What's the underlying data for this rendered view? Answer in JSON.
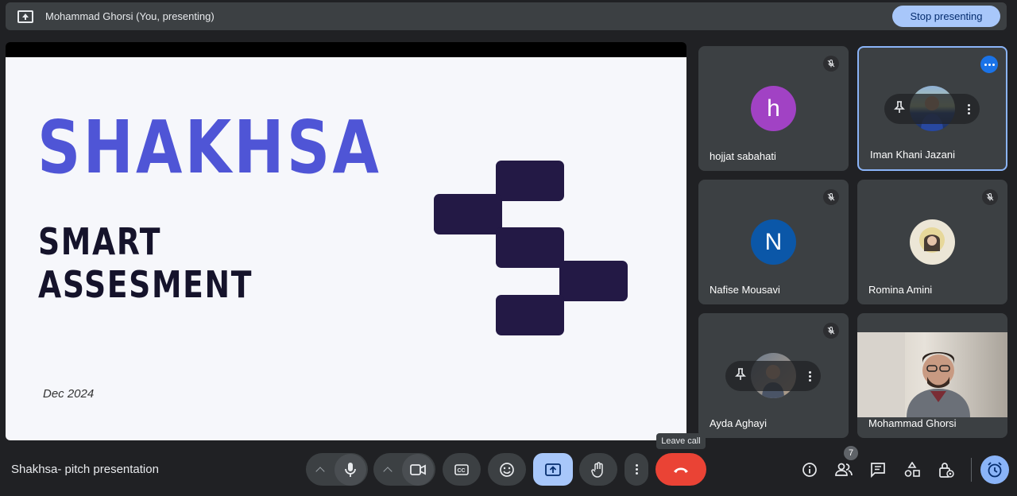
{
  "topbar": {
    "title": "Mohammad Ghorsi (You, presenting)",
    "stop_label": "Stop presenting",
    "icon": "present-to-all-icon"
  },
  "slide": {
    "brand": "SHAKHSA",
    "subtitle": "SMART\nASSESMENT",
    "date": "Dec 2024",
    "brand_color": "#4f55d6",
    "logo_color": "#231945"
  },
  "participants": [
    {
      "name": "hojjat sabahati",
      "avatar_letter": "h",
      "avatar_color": "#a142c4",
      "muted": true
    },
    {
      "name": "Iman Khani Jazani",
      "avatar": "photo",
      "active": true
    },
    {
      "name": "Nafise Mousavi",
      "avatar_letter": "N",
      "avatar_color": "#0b57a8",
      "muted": true
    },
    {
      "name": "Romina Amini",
      "avatar": "photo",
      "muted": true
    },
    {
      "name": "Ayda Aghayi",
      "avatar": "photo",
      "muted": true
    },
    {
      "name": "Mohammad Ghorsi",
      "avatar": "video"
    }
  ],
  "bottom": {
    "meeting_name": "Shakhsa- pitch presentation",
    "leave_tooltip": "Leave call",
    "people_count": "7",
    "icons": [
      "mic-icon",
      "camera-icon",
      "captions-icon",
      "emoji-icon",
      "present-icon",
      "raise-hand-icon",
      "more-icon",
      "leave-call-icon",
      "info-icon",
      "people-icon",
      "chat-icon",
      "activities-icon",
      "host-controls-icon",
      "timer-icon"
    ]
  },
  "colors": {
    "background": "#202124",
    "surface": "#3c4043",
    "accent": "#a8c7fa",
    "leave": "#ea4335"
  }
}
